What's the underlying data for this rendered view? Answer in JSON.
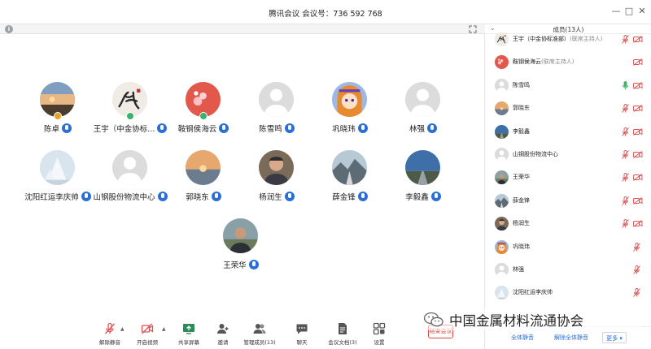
{
  "window": {
    "title": "腾讯会议 会议号：736 592 768"
  },
  "participants": [
    {
      "name": "陈卓",
      "mic": "on",
      "host_badge": "gold",
      "avatar": "photo-sunset"
    },
    {
      "name": "王宇（中金协标...",
      "mic": "on",
      "host_badge": "green",
      "avatar": "calligraphy"
    },
    {
      "name": "鞍钢侯海云",
      "mic": "on",
      "host_badge": "green",
      "avatar": "pink-floral"
    },
    {
      "name": "陈雪鸣",
      "mic": "on",
      "host_badge": "none",
      "avatar": "default"
    },
    {
      "name": "巩晓玮",
      "mic": "on",
      "host_badge": "none",
      "avatar": "anime"
    },
    {
      "name": "林强",
      "mic": "on",
      "host_badge": "none",
      "avatar": "default"
    },
    {
      "name": "沈阳红运李庆帅",
      "mic": "on",
      "host_badge": "none",
      "avatar": "snow-tree"
    },
    {
      "name": "山钢股份物流中心",
      "mic": "on",
      "host_badge": "none",
      "avatar": "default"
    },
    {
      "name": "郭晓东",
      "mic": "on",
      "host_badge": "none",
      "avatar": "sunset-sea"
    },
    {
      "name": "杨润生",
      "mic": "on",
      "host_badge": "none",
      "avatar": "man-portrait"
    },
    {
      "name": "薛金锋",
      "mic": "on",
      "host_badge": "none",
      "avatar": "mountain-road"
    },
    {
      "name": "李毅鑫",
      "mic": "on",
      "host_badge": "none",
      "avatar": "blue-sky-road"
    },
    {
      "name": "王荣华",
      "mic": "on",
      "host_badge": "none",
      "avatar": "man-outdoor"
    }
  ],
  "bottom_toolbar": {
    "items": [
      {
        "label": "解除静音",
        "icon": "mic-muted-icon"
      },
      {
        "label": "开启视频",
        "icon": "camera-off-icon"
      },
      {
        "label": "共享屏幕",
        "icon": "screen-share-icon"
      },
      {
        "label": "邀请",
        "icon": "invite-icon"
      },
      {
        "label": "管理成员(13)",
        "icon": "members-icon"
      },
      {
        "label": "聊天",
        "icon": "chat-icon"
      },
      {
        "label": "会议文档(3)",
        "icon": "document-icon"
      },
      {
        "label": "设置",
        "icon": "settings-icon"
      }
    ],
    "end_label": "结束会议"
  },
  "members_panel": {
    "title": "成员(13人)",
    "members": [
      {
        "name": "王宇（中金协标准部）",
        "role": "(联席主持人)",
        "avatar": "calligraphy",
        "mic": "muted"
      },
      {
        "name": "鞍钢侯海云",
        "role": "(联席主持人)",
        "avatar": "pink-floral",
        "mic": "none"
      },
      {
        "name": "陈雪鸣",
        "role": "",
        "avatar": "default",
        "mic": "active"
      },
      {
        "name": "郭晓东",
        "role": "",
        "avatar": "sunset-sea",
        "mic": "muted"
      },
      {
        "name": "李毅鑫",
        "role": "",
        "avatar": "blue-sky-road",
        "mic": "muted"
      },
      {
        "name": "山钢股份物流中心",
        "role": "",
        "avatar": "default",
        "mic": "muted"
      },
      {
        "name": "王荣华",
        "role": "",
        "avatar": "man-outdoor",
        "mic": "muted"
      },
      {
        "name": "薛金锋",
        "role": "",
        "avatar": "mountain-road",
        "mic": "muted"
      },
      {
        "name": "杨润生",
        "role": "",
        "avatar": "man-portrait",
        "mic": "muted"
      },
      {
        "name": "巩晓玮",
        "role": "",
        "avatar": "anime",
        "mic": "muted-only"
      },
      {
        "name": "林强",
        "role": "",
        "avatar": "default",
        "mic": "muted-only"
      },
      {
        "name": "沈阳红运李庆帅",
        "role": "",
        "avatar": "snow-tree",
        "mic": "muted-only"
      }
    ],
    "footer": {
      "mute_all": "全体静音",
      "unmute_all": "解除全体静音",
      "more": "更多"
    }
  },
  "watermark": {
    "text": "中国金属材料流通协会"
  },
  "colors": {
    "accent_blue": "#2b6fd6",
    "active_green": "#3bb463",
    "end_red": "#e0493e",
    "muted_red": "#e05050"
  }
}
